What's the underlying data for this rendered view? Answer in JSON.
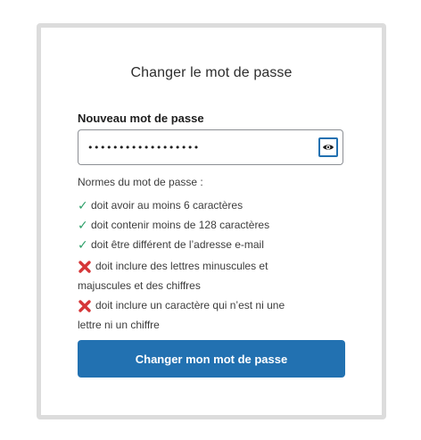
{
  "form": {
    "title": "Changer le mot de passe",
    "new_password_label": "Nouveau mot de passe",
    "password_value": "••••••••••••••••••",
    "toggle_visibility_icon": "eye-icon"
  },
  "rules": {
    "heading": "Normes du mot de passe :",
    "items": [
      {
        "status": "pass",
        "text": "doit avoir au moins 6 caractères"
      },
      {
        "status": "pass",
        "text": "doit contenir moins de 128 caractères"
      },
      {
        "status": "pass",
        "text": "doit être différent de l’adresse e-mail"
      },
      {
        "status": "fail",
        "text": "doit inclure des lettres minuscules et majuscules et des chiffres"
      },
      {
        "status": "fail",
        "text": "doit inclure un caractère qui n’est ni une lettre ni un chiffre"
      }
    ]
  },
  "submit_label": "Changer mon mot de passe",
  "colors": {
    "accent": "#2271b1",
    "pass": "#2ea06a",
    "fail": "#d63638",
    "card_border": "#dcdcdc"
  }
}
